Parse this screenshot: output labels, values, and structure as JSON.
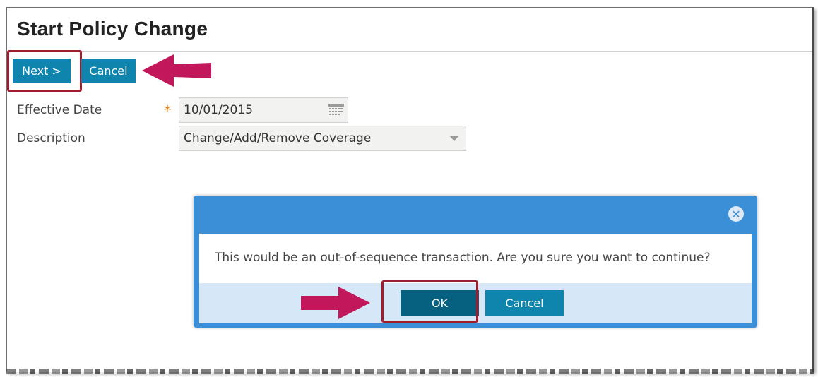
{
  "page": {
    "title": "Start Policy Change"
  },
  "toolbar": {
    "next_label_underlined": "N",
    "next_label_rest": "ext >",
    "cancel_label": "Cancel"
  },
  "form": {
    "effective_date": {
      "label": "Effective Date",
      "required_marker": "*",
      "value": "10/01/2015"
    },
    "description": {
      "label": "Description",
      "value": "Change/Add/Remove Coverage"
    }
  },
  "dialog": {
    "message": "This would be an out-of-sequence transaction. Are you sure you want to continue?",
    "ok_label": "OK",
    "cancel_label": "Cancel"
  },
  "colors": {
    "button": "#0f84ad",
    "ok_button": "#05617f",
    "dialog_header": "#3a8fd6",
    "dialog_footer": "#d6e8f7",
    "highlight": "#a11c2e",
    "arrow": "#c2185b",
    "required": "#e07d12"
  },
  "icons": {
    "date_picker": "calendar-icon",
    "dropdown": "chevron-down-icon",
    "dialog_close": "close-icon"
  }
}
